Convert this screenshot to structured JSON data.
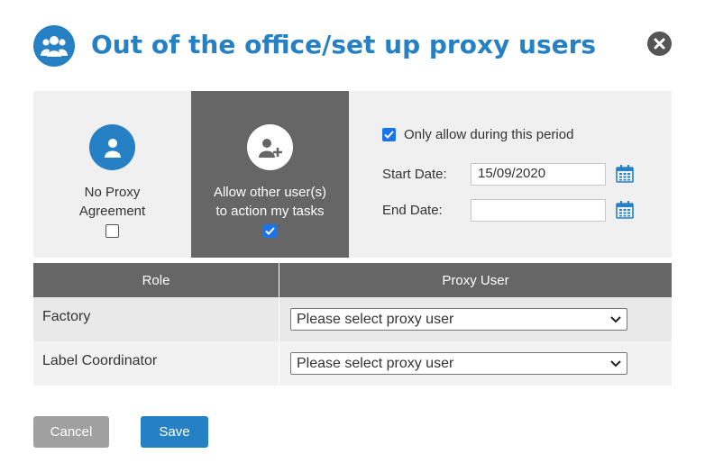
{
  "dialog": {
    "title": "Out of the office/set up proxy users",
    "title_icon": "users-group-icon",
    "close_icon": "close-icon"
  },
  "agreement": {
    "options": [
      {
        "label": "No Proxy\nAgreement",
        "icon": "user-icon",
        "checked": false,
        "selected": false
      },
      {
        "label": "Allow other user(s)\nto action my tasks",
        "icon": "user-add-icon",
        "checked": true,
        "selected": true
      }
    ],
    "period": {
      "checkbox_label": "Only allow during this period",
      "checked": true,
      "start_label": "Start Date:",
      "start_value": "15/09/2020",
      "end_label": "End Date:",
      "end_value": ""
    }
  },
  "table": {
    "headers": [
      "Role",
      "Proxy User"
    ],
    "rows": [
      {
        "role": "Factory",
        "proxy": "Please select proxy user"
      },
      {
        "role": "Label Coordinator",
        "proxy": "Please select proxy user"
      }
    ]
  },
  "buttons": {
    "cancel": "Cancel",
    "save": "Save"
  },
  "colors": {
    "accent": "#2581c4",
    "dark_panel": "#666666",
    "checkbox": "#1a73e8"
  }
}
